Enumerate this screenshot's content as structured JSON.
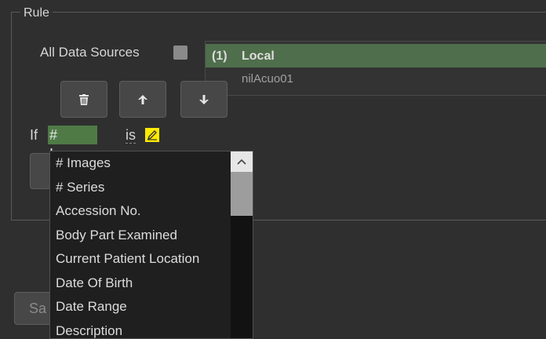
{
  "rule": {
    "legend": "Rule",
    "all_data_sources_label": "All Data Sources",
    "all_data_sources_checked": false
  },
  "sources": [
    {
      "num": "(1)",
      "name": "Local",
      "selected": true
    },
    {
      "name": "nilAcuo01"
    }
  ],
  "buttons": {
    "delete_icon": "trash-icon",
    "up_icon": "arrow-up-icon",
    "down_icon": "arrow-down-icon"
  },
  "condition": {
    "if_word": "If",
    "field": "# Images",
    "operator": "is",
    "value_icon": "edit-pencil-icon"
  },
  "save_button_text": "Sa",
  "dropdown": {
    "items": [
      "# Images",
      "# Series",
      "Accession No.",
      "Body Part Examined",
      "Current Patient Location",
      "Date Of Birth",
      "Date Range",
      "Description"
    ]
  },
  "colors": {
    "selected_source": "#4f6e4b",
    "field_chip": "#4f7a46",
    "edit_chip": "#ffea00"
  }
}
